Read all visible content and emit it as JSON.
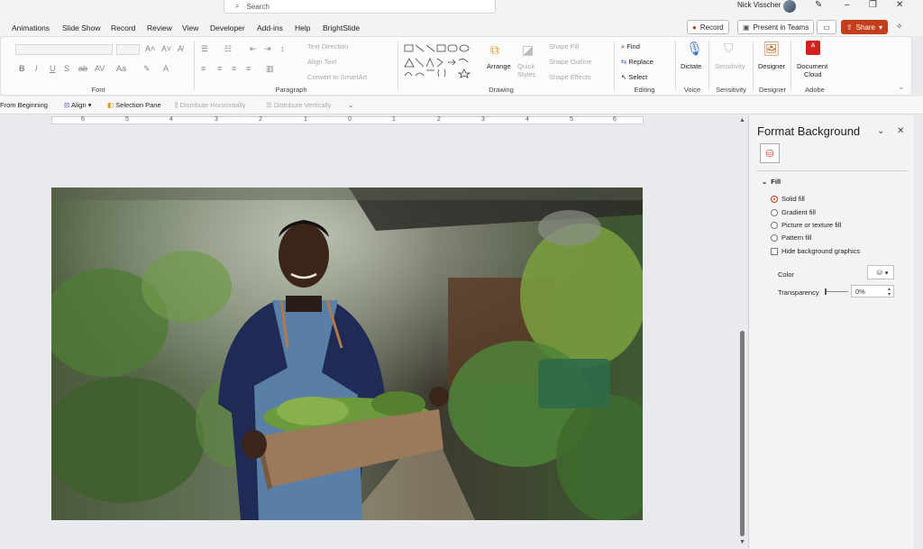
{
  "titlebar": {
    "search_placeholder": "Search",
    "user_name": "Nick Visscher",
    "minimize": "–",
    "restore": "❐",
    "close": "✕"
  },
  "tabs": [
    "Animations",
    "Slide Show",
    "Record",
    "Review",
    "View",
    "Developer",
    "Add-ins",
    "Help",
    "BrightSlide"
  ],
  "actions": {
    "record": "Record",
    "present_in_teams": "Present in Teams",
    "share": "Share"
  },
  "ribbon": {
    "groups": [
      "Font",
      "Paragraph",
      "Drawing",
      "Editing",
      "Voice",
      "Sensitivity",
      "Designer",
      "Adobe"
    ],
    "paragraph": {
      "text_direction": "Text Direction",
      "align_text": "Align Text",
      "convert_smartart": "Convert to SmartArt"
    },
    "drawing": {
      "arrange": "Arrange",
      "quick_styles": "Quick Styles",
      "shape_fill": "Shape Fill",
      "shape_outline": "Shape Outline",
      "shape_effects": "Shape Effects"
    },
    "editing": {
      "find": "Find",
      "replace": "Replace",
      "select": "Select"
    },
    "voice": {
      "dictate": "Dictate"
    },
    "sensitivity": {
      "label": "Sensitivity"
    },
    "designer": {
      "label": "Designer"
    },
    "adobe": {
      "label_line1": "Document",
      "label_line2": "Cloud"
    }
  },
  "qat": {
    "from_beginning": "From Beginning",
    "align": "Align",
    "selection_pane": "Selection Pane",
    "distribute_h": "Distribute Horizontally",
    "distribute_v": "Distribute Vertically"
  },
  "ruler": {
    "numbers": [
      "6",
      "5",
      "4",
      "3",
      "2",
      "1",
      "0",
      "1",
      "2",
      "3",
      "4",
      "5",
      "6"
    ]
  },
  "pane": {
    "title": "Format Background",
    "section": "Fill",
    "options": [
      "Solid fill",
      "Gradient fill",
      "Picture or texture fill",
      "Pattern fill"
    ],
    "selected_option": "Solid fill",
    "hide_graphics": "Hide background graphics",
    "color_label": "Color",
    "transparency_label": "Transparency",
    "transparency_value": "0%"
  },
  "colors": {
    "accent": "#c43e1c",
    "pane_bg": "#f3f3f3"
  }
}
